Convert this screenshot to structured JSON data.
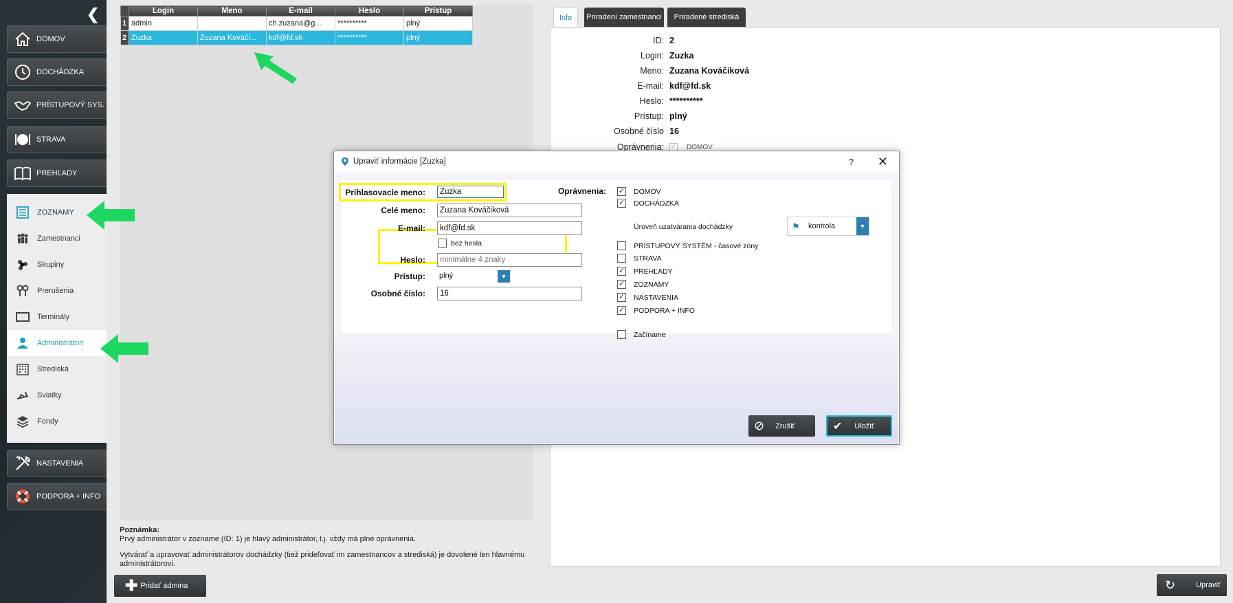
{
  "sidebar": {
    "nav": [
      {
        "label": "DOMOV",
        "icon": "home-icon"
      },
      {
        "label": "DOCHÁDZKA",
        "icon": "clock-icon"
      },
      {
        "label": "PRÍSTUPOVÝ SYS.",
        "icon": "handshake-icon"
      },
      {
        "label": "STRAVA",
        "icon": "plate-icon"
      },
      {
        "label": "PREHĽADY",
        "icon": "book-icon"
      }
    ],
    "zoznamy": {
      "label": "ZOZNAMY",
      "items": [
        {
          "label": "Zamestnanci",
          "icon": "people-icon"
        },
        {
          "label": "Skupiny",
          "icon": "groups-icon"
        },
        {
          "label": "Prerušenia",
          "icon": "pins-icon"
        },
        {
          "label": "Terminály",
          "icon": "terminal-icon"
        },
        {
          "label": "Administrátori",
          "icon": "admin-icon"
        },
        {
          "label": "Strediská",
          "icon": "building-icon"
        },
        {
          "label": "Sviatky",
          "icon": "holiday-icon"
        },
        {
          "label": "Fondy",
          "icon": "layers-icon"
        }
      ]
    },
    "bottom": [
      {
        "label": "NASTAVENIA",
        "icon": "tools-icon"
      },
      {
        "label": "PODPORA + INFO",
        "icon": "lifebuoy-icon"
      }
    ]
  },
  "admins_table": {
    "headers": [
      "Login",
      "Meno",
      "E-mail",
      "Heslo",
      "Prístup"
    ],
    "rows": [
      {
        "idx": "1",
        "login": "admin",
        "meno": "",
        "email": "ch.zuzana@g...",
        "heslo": "**********",
        "pristup": "plný"
      },
      {
        "idx": "2",
        "login": "Zuzka",
        "meno": "Zuzana Kováči...",
        "email": "kdf@fd.sk",
        "heslo": "**********",
        "pristup": "plný"
      }
    ]
  },
  "note": {
    "title": "Poznámka:",
    "line1": "Prvý administrátor v zozname (ID: 1) je hlavý administrátor, t.j. vždy má plné oprávnenia.",
    "line2": "Vytvárať a upravovať administrátorov dochádzky (tiež prideľovať im zamestnancov a strediská) je dovolené len hlavnému administrátorovi."
  },
  "add_admin_label": "Pridať admina",
  "tabs": [
    "Info",
    "Priradení zamestnanci",
    "Priradené strediská"
  ],
  "info": [
    {
      "label": "ID:",
      "value": "2"
    },
    {
      "label": "Login:",
      "value": "Zuzka"
    },
    {
      "label": "Meno:",
      "value": "Zuzana Kováčiková"
    },
    {
      "label": "E-mail:",
      "value": "kdf@fd.sk"
    },
    {
      "label": "Heslo:",
      "value": "**********"
    },
    {
      "label": "Prístup:",
      "value": "plný"
    },
    {
      "label": "Osobné číslo",
      "value": "16"
    }
  ],
  "info_permissions_label": "Oprávnenia:",
  "info_permissions_first": "DOMOV",
  "refresh_label": "Upraviť",
  "dialog": {
    "title": "Upraviť informácie [Zuzka]",
    "help": "?",
    "close": "✕",
    "login_label": "Prihlasovacie meno:",
    "login_value": "Zuzka",
    "fullname_label": "Celé meno:",
    "fullname_value": "Zuzana Kováčiková",
    "email_label": "E-mail:",
    "email_value": "kdf@fd.sk",
    "no_password_label": "bez hesla",
    "password_label": "Heslo:",
    "password_placeholder": "minimálne 4 znaky",
    "access_label": "Prístup:",
    "access_value": "plný",
    "personal_no_label": "Osobné číslo:",
    "personal_no_value": "16",
    "permissions_label": "Oprávnenia:",
    "permissions": [
      {
        "label": "DOMOV",
        "checked": true
      },
      {
        "label": "DOCHÁDZKA",
        "checked": true
      },
      {
        "label": "PRÍSTUPOVÝ SYSTÉM - časové zóny",
        "checked": false
      },
      {
        "label": "STRAVA",
        "checked": false
      },
      {
        "label": "PREHĽADY",
        "checked": true
      },
      {
        "label": "ZOZNAMY",
        "checked": true
      },
      {
        "label": "NASTAVENIA",
        "checked": true
      },
      {
        "label": "PODPORA + INFO",
        "checked": true
      },
      {
        "label": "Začíname",
        "checked": false
      }
    ],
    "closing_level_label": "Úroveň uzatvárania dochádzky",
    "closing_level_value": "kontrola",
    "cancel_label": "Zrušiť",
    "save_label": "Uložiť"
  },
  "colors": {
    "accent": "#2ab8df",
    "highlight": "#fff200",
    "arrow": "#1ed760",
    "sidebar": "#263036"
  }
}
